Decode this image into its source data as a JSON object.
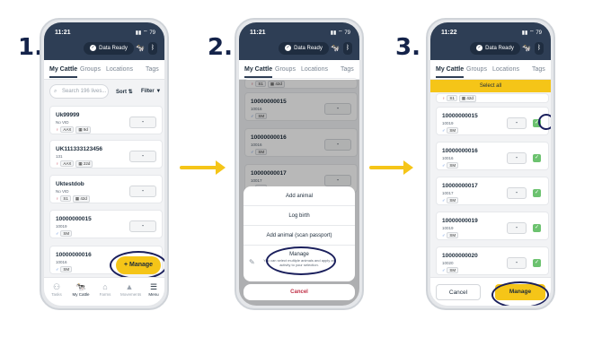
{
  "steps": [
    "1.",
    "2.",
    "3."
  ],
  "status": {
    "times": [
      "11:21",
      "11:21",
      "11:22"
    ],
    "battery": "79",
    "sync_label": "Data Ready"
  },
  "tabs": [
    "My Cattle",
    "Groups",
    "Locations",
    "Tags"
  ],
  "toolbar": {
    "search_placeholder": "Search 196 lives...",
    "sort_label": "Sort",
    "filter_label": "Filter"
  },
  "screen1": {
    "cards": [
      {
        "title": "Uk99999",
        "sub": "No VID",
        "breed": "AAX",
        "age": "9d"
      },
      {
        "title": "UK111333123456",
        "sub": "131",
        "breed": "AAX",
        "age": "22d"
      },
      {
        "title": "Uktestdob",
        "sub": "No VID",
        "breed": "S1",
        "age": "42d"
      },
      {
        "title": "10000000015",
        "sub": "10019",
        "breed": "SM",
        "age": ""
      },
      {
        "title": "10000000016",
        "sub": "10016",
        "breed": "SM",
        "age": ""
      }
    ],
    "dash": "-",
    "manage_label": "Manage",
    "nav": [
      "Tasks",
      "My Cattle",
      "Farms",
      "Movements",
      "Menu"
    ]
  },
  "screen2": {
    "cards": [
      {
        "title": "10000000015",
        "sub": "10016",
        "breed": "SM"
      },
      {
        "title": "10000000016",
        "sub": "10016",
        "breed": "SM"
      },
      {
        "title": "10000000017",
        "sub": "10017",
        "breed": "SM"
      }
    ],
    "partial_tag": "S1",
    "partial_age": "42d",
    "sheet": {
      "add_animal": "Add animal",
      "log_birth": "Log birth",
      "add_scan": "Add animal (scan passport)",
      "manage_title": "Manage",
      "manage_desc": "You can select multiple animals and apply an activity to your selection.",
      "cancel": "Cancel"
    }
  },
  "screen3": {
    "select_all": "Select all",
    "partial_tag": "S1",
    "partial_age": "42d",
    "cards": [
      {
        "title": "10000000015",
        "sub": "10019",
        "breed": "SM"
      },
      {
        "title": "10000000016",
        "sub": "10016",
        "breed": "SM"
      },
      {
        "title": "10000000017",
        "sub": "10017",
        "breed": "SM"
      },
      {
        "title": "10000000019",
        "sub": "10019",
        "breed": "SM"
      },
      {
        "title": "10000000020",
        "sub": "10020",
        "breed": "SM"
      }
    ],
    "cancel_label": "Cancel",
    "manage_label": "Manage"
  },
  "colors": {
    "navy": "#2e3e55",
    "accent": "#f5c518",
    "ring": "#1a1f5c",
    "checkbox": "#6cc26f"
  }
}
